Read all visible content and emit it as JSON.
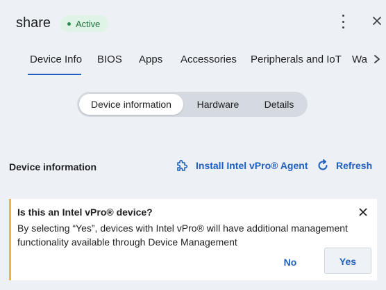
{
  "header": {
    "title": "share",
    "status_badge": "Active",
    "more_icon": "kebab-vertical-icon",
    "close_icon": "close-icon"
  },
  "tabs": [
    {
      "label": "Device Info",
      "active": true
    },
    {
      "label": "BIOS",
      "active": false
    },
    {
      "label": "Apps",
      "active": false
    },
    {
      "label": "Accessories",
      "active": false
    },
    {
      "label": "Peripherals and IoT",
      "active": false
    },
    {
      "label": "Wa",
      "active": false
    }
  ],
  "tab_scroll_icon": "chevron-right-icon",
  "segment": {
    "items": [
      "Device information",
      "Hardware",
      "Details"
    ],
    "selected": "Device information"
  },
  "section": {
    "title": "Device information",
    "install_label": "Install Intel vPro® Agent",
    "install_icon": "puzzle-icon",
    "refresh_label": "Refresh",
    "refresh_icon": "refresh-icon"
  },
  "banner": {
    "title": "Is this an Intel vPro® device?",
    "text": "By selecting “Yes”, devices with Intel vPro® will have additional management functionality available through Device Management",
    "no_label": "No",
    "yes_label": "Yes",
    "accent_color": "#f0b43c"
  },
  "colors": {
    "background": "#edf0f5",
    "accent": "#1f5fbf",
    "badge_bg": "#dff3e6",
    "badge_text": "#1f6f3f"
  }
}
